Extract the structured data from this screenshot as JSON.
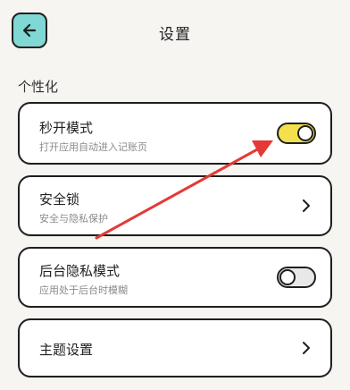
{
  "header": {
    "title": "设置",
    "back_icon": "arrow-left-icon"
  },
  "section": {
    "title": "个性化"
  },
  "items": [
    {
      "title": "秒开模式",
      "subtitle": "打开应用自动进入记账页",
      "control": "toggle",
      "on": true
    },
    {
      "title": "安全锁",
      "subtitle": "安全与隐私保护",
      "control": "chevron"
    },
    {
      "title": "后台隐私模式",
      "subtitle": "应用处于后台时模糊",
      "control": "toggle",
      "on": false
    },
    {
      "title": "主题设置",
      "control": "chevron"
    }
  ],
  "colors": {
    "back_button": "#7fd8d4",
    "toggle_on": "#f4e04d",
    "toggle_off": "#e8e8e8",
    "annotation_arrow": "#e53935"
  }
}
